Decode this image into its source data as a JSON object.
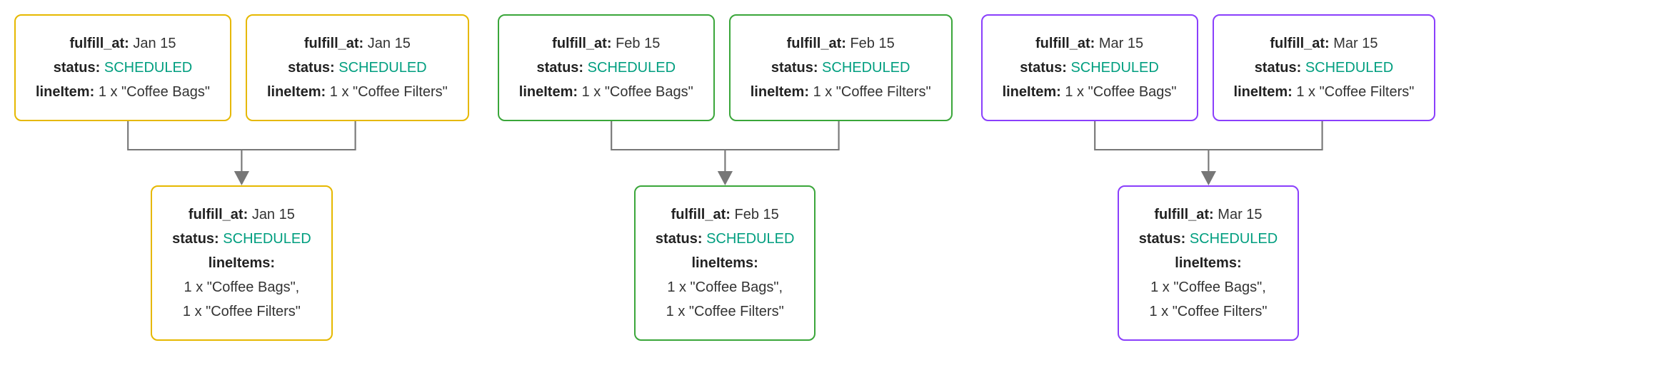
{
  "labels": {
    "fulfill_at": "fulfill_at:",
    "status": "status:",
    "lineItem": "lineItem:",
    "lineItems": "lineItems:"
  },
  "status_value": "SCHEDULED",
  "groups": [
    {
      "color": "yellow",
      "date": "Jan 15",
      "top": [
        {
          "line_item": "1 x \"Coffee Bags\""
        },
        {
          "line_item": "1 x \"Coffee Filters\""
        }
      ],
      "merged": {
        "line_items": [
          "1 x \"Coffee Bags\",",
          "1 x \"Coffee Filters\""
        ]
      }
    },
    {
      "color": "green",
      "date": "Feb 15",
      "top": [
        {
          "line_item": "1 x \"Coffee Bags\""
        },
        {
          "line_item": "1 x \"Coffee Filters\""
        }
      ],
      "merged": {
        "line_items": [
          "1 x \"Coffee Bags\",",
          "1 x \"Coffee Filters\""
        ]
      }
    },
    {
      "color": "purple",
      "date": "Mar 15",
      "top": [
        {
          "line_item": "1 x \"Coffee Bags\""
        },
        {
          "line_item": "1 x \"Coffee Filters\""
        }
      ],
      "merged": {
        "line_items": [
          "1 x \"Coffee Bags\",",
          "1 x \"Coffee Filters\""
        ]
      }
    }
  ]
}
